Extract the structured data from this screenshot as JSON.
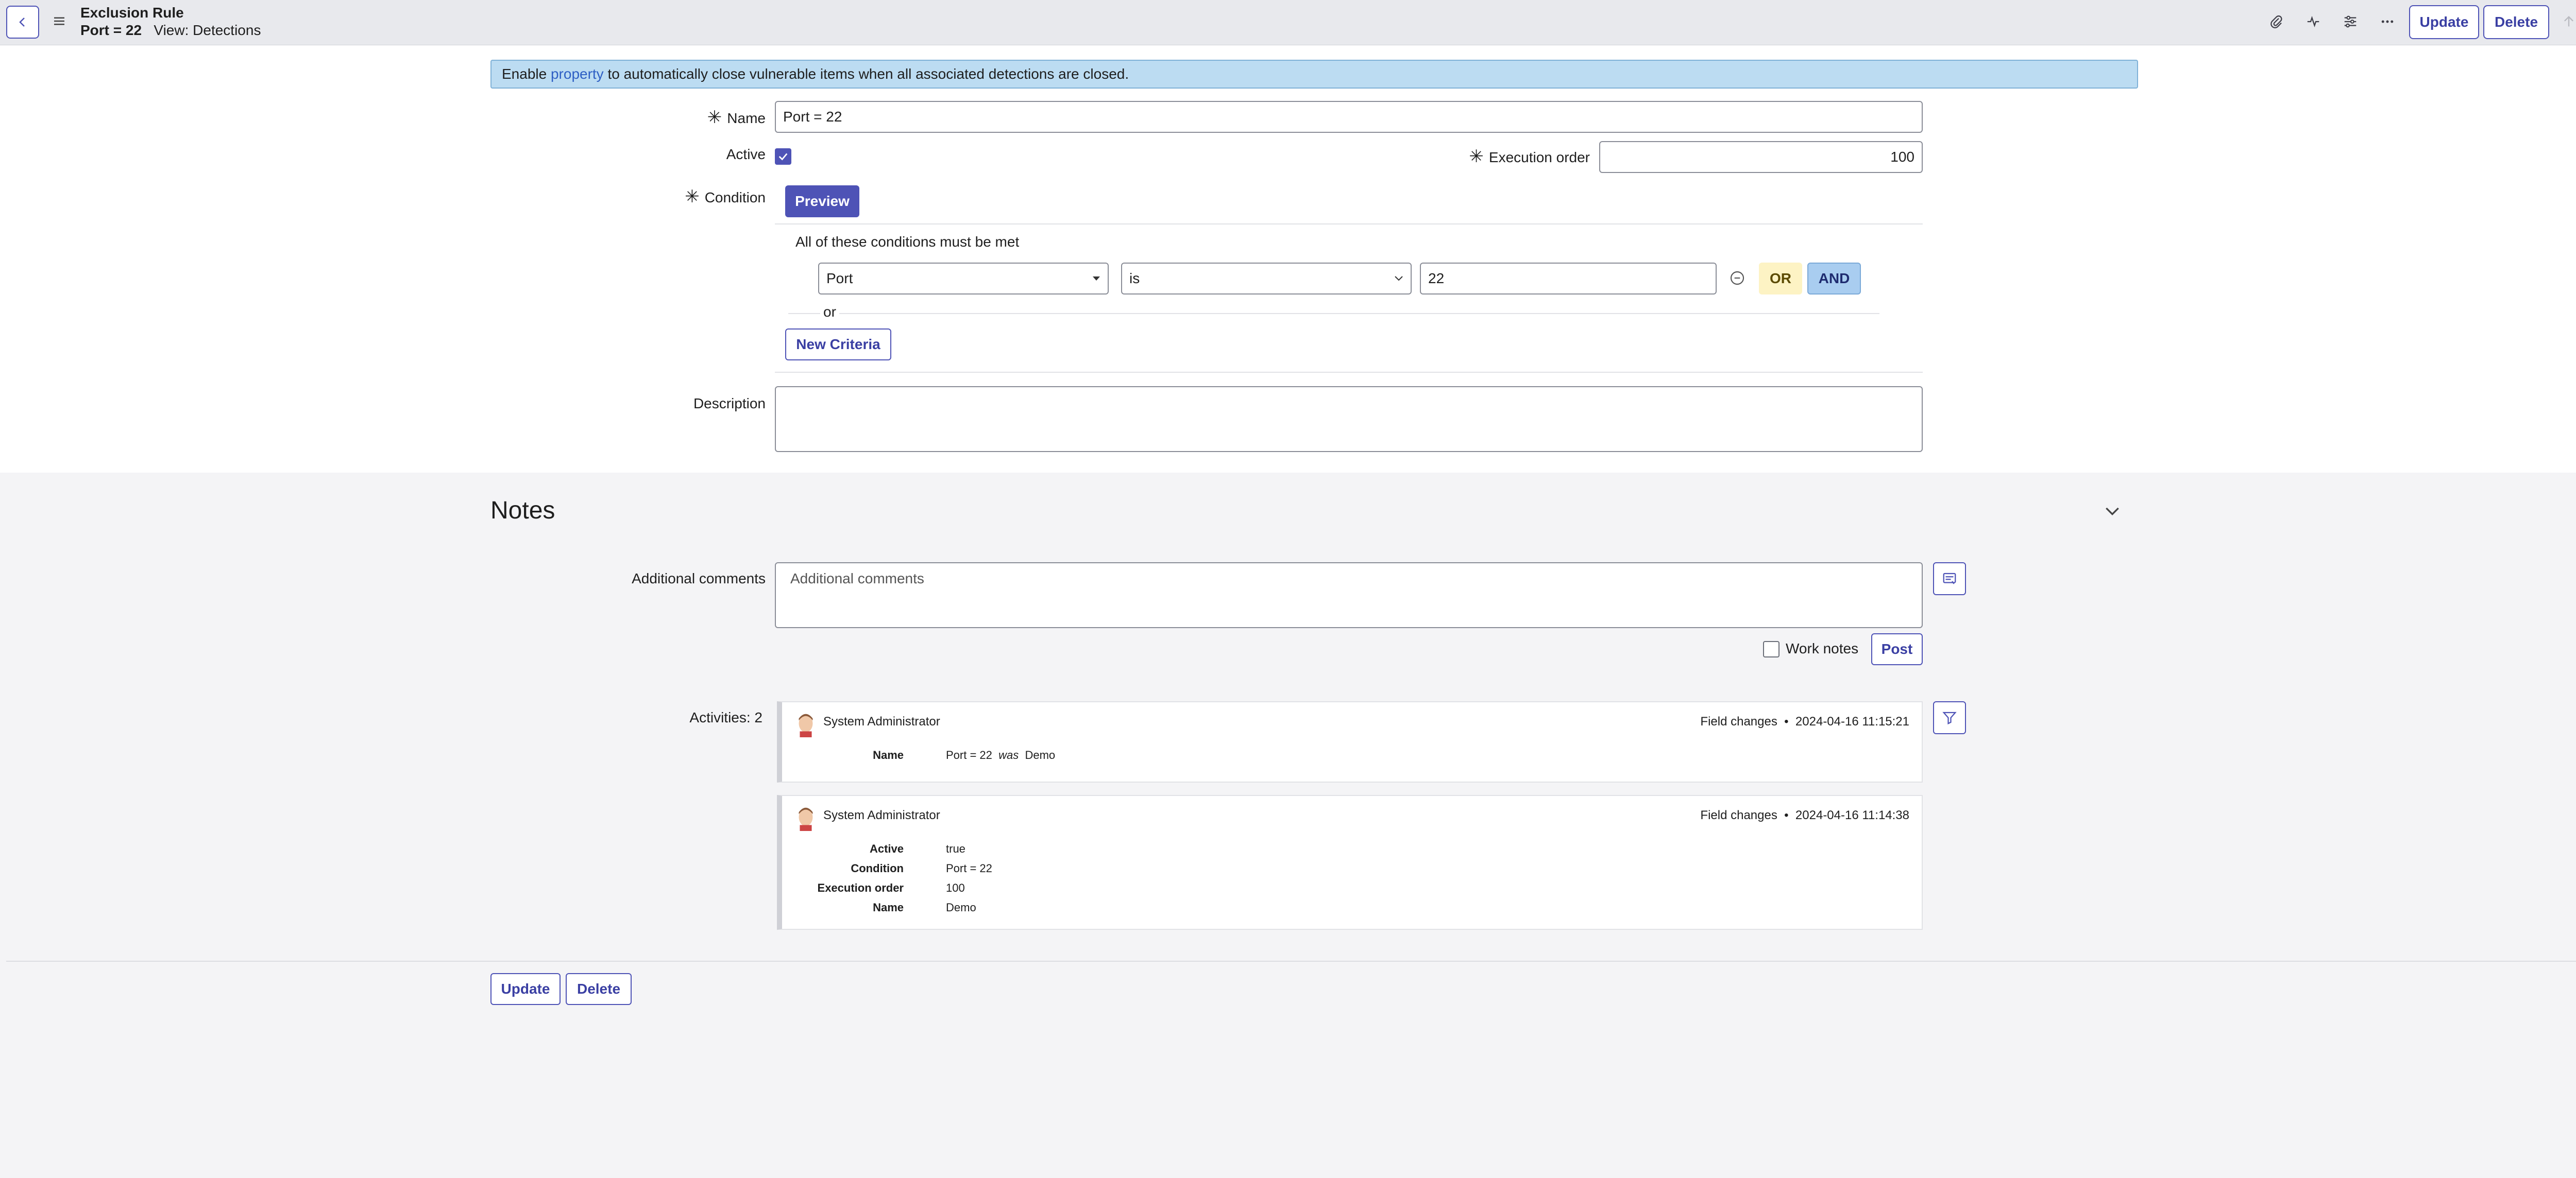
{
  "header": {
    "title": "Exclusion Rule",
    "record": "Port = 22",
    "view": "View: Detections",
    "update_label": "Update",
    "delete_label": "Delete"
  },
  "banner": {
    "prefix": "Enable ",
    "link": "property",
    "suffix": " to automatically close vulnerable items when all associated detections are closed."
  },
  "form": {
    "name_label": "Name",
    "name_value": "Port = 22",
    "active_label": "Active",
    "active_checked": true,
    "execution_order_label": "Execution order",
    "execution_order_value": "100",
    "condition_label": "Condition",
    "preview_label": "Preview",
    "conditions_heading": "All of these conditions must be met",
    "condition_field": "Port",
    "condition_operator": "is",
    "condition_value": "22",
    "or_label": "OR",
    "and_label": "AND",
    "or_text": "or",
    "new_criteria_label": "New Criteria",
    "description_label": "Description",
    "description_value": ""
  },
  "notes": {
    "title": "Notes",
    "additional_comments_label": "Additional comments",
    "additional_comments_placeholder": "Additional comments",
    "work_notes_label": "Work notes",
    "post_label": "Post",
    "activities_label": "Activities: 2"
  },
  "activities": [
    {
      "user": "System Administrator",
      "type": "Field changes",
      "timestamp": "2024-04-16 11:15:21",
      "fields": [
        {
          "key": "Name",
          "value": "Port = 22",
          "was": "was",
          "old": "Demo"
        }
      ]
    },
    {
      "user": "System Administrator",
      "type": "Field changes",
      "timestamp": "2024-04-16 11:14:38",
      "fields": [
        {
          "key": "Active",
          "value": "true"
        },
        {
          "key": "Condition",
          "value": "Port = 22"
        },
        {
          "key": "Execution order",
          "value": "100"
        },
        {
          "key": "Name",
          "value": "Demo"
        }
      ]
    }
  ],
  "footer": {
    "update_label": "Update",
    "delete_label": "Delete"
  },
  "colors": {
    "accent": "#4e53b6",
    "banner": "#bcdcf2",
    "or_pill": "#fdf3c4",
    "and_pill": "#a9cdf0"
  }
}
